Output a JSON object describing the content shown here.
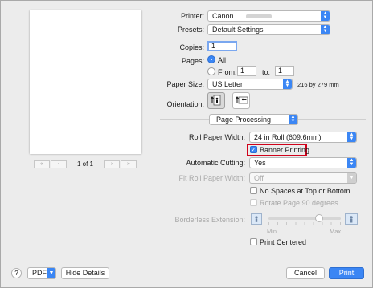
{
  "printer": {
    "label": "Printer:",
    "value": "Canon"
  },
  "presets": {
    "label": "Presets:",
    "value": "Default Settings"
  },
  "copies": {
    "label": "Copies:",
    "value": "1"
  },
  "pages": {
    "label": "Pages:",
    "all_label": "All",
    "from_label": "From:",
    "from_value": "1",
    "to_label": "to:",
    "to_value": "1"
  },
  "paper_size": {
    "label": "Paper Size:",
    "value": "US Letter",
    "dimensions": "216 by 279 mm"
  },
  "orientation": {
    "label": "Orientation:"
  },
  "section": {
    "value": "Page Processing"
  },
  "roll_paper_width": {
    "label": "Roll Paper Width:",
    "value": "24 in Roll (609.6mm)"
  },
  "banner_printing": {
    "label": "Banner Printing",
    "checked": true,
    "highlight_color": "#d0021b"
  },
  "automatic_cutting": {
    "label": "Automatic Cutting:",
    "value": "Yes"
  },
  "fit_roll_paper_width": {
    "label": "Fit Roll Paper Width:",
    "value": "Off"
  },
  "no_spaces": {
    "label": "No Spaces at Top or Bottom",
    "checked": false
  },
  "rotate_page": {
    "label": "Rotate Page 90 degrees",
    "checked": false
  },
  "borderless_extension": {
    "label": "Borderless Extension:",
    "min_label": "Min",
    "max_label": "Max",
    "level": 0.72
  },
  "print_centered": {
    "label": "Print Centered",
    "checked": false
  },
  "preview": {
    "page_indicator": "1 of 1"
  },
  "footer": {
    "help": "?",
    "pdf": "PDF",
    "hide_details": "Hide Details",
    "cancel": "Cancel",
    "print": "Print"
  },
  "colors": {
    "accent": "#3b86f4"
  }
}
